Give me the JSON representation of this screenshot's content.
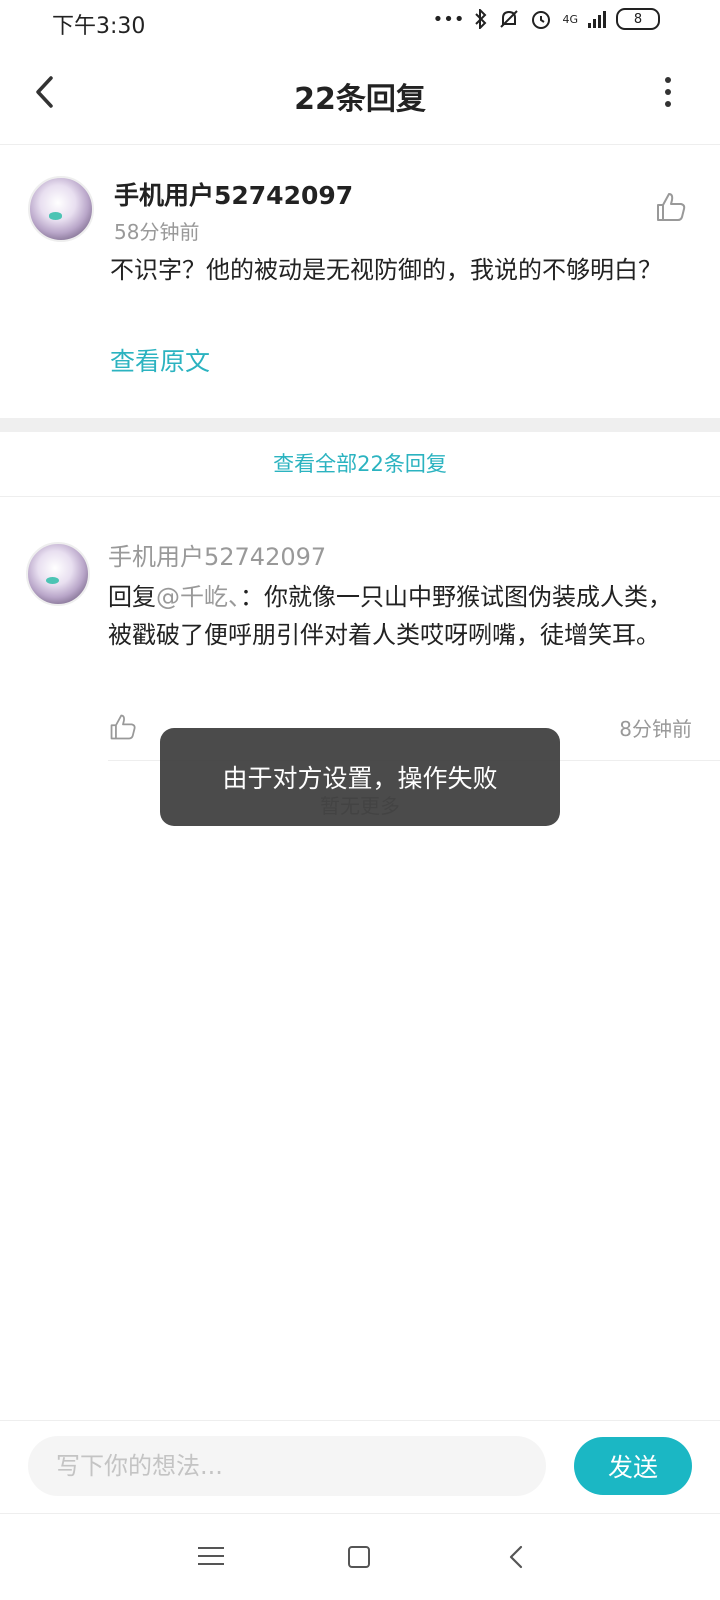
{
  "status_bar": {
    "time": "下午3:30",
    "dots": "•••",
    "network": "4G",
    "battery": "8"
  },
  "header": {
    "title": "22条回复"
  },
  "main_comment": {
    "username": "手机用户52742097",
    "time": "58分钟前",
    "content": "不识字？他的被动是无视防御的，我说的不够明白？",
    "view_original": "查看原文"
  },
  "view_all_label": "查看全部22条回复",
  "reply": {
    "username": "手机用户52742097",
    "prefix": "回复",
    "mention": "@千屹、",
    "content": "：你就像一只山中野猴试图伪装成人类，被戳破了便呼朋引伴对着人类哎呀咧嘴，徒增笑耳。",
    "time": "8分钟前"
  },
  "no_more": "暂无更多",
  "toast": "由于对方设置，操作失败",
  "input": {
    "placeholder": "写下你的想法...",
    "send_label": "发送"
  },
  "colors": {
    "accent": "#1bb7c4",
    "link": "#2bb3c0",
    "toast_bg": "#3c3c3c"
  }
}
